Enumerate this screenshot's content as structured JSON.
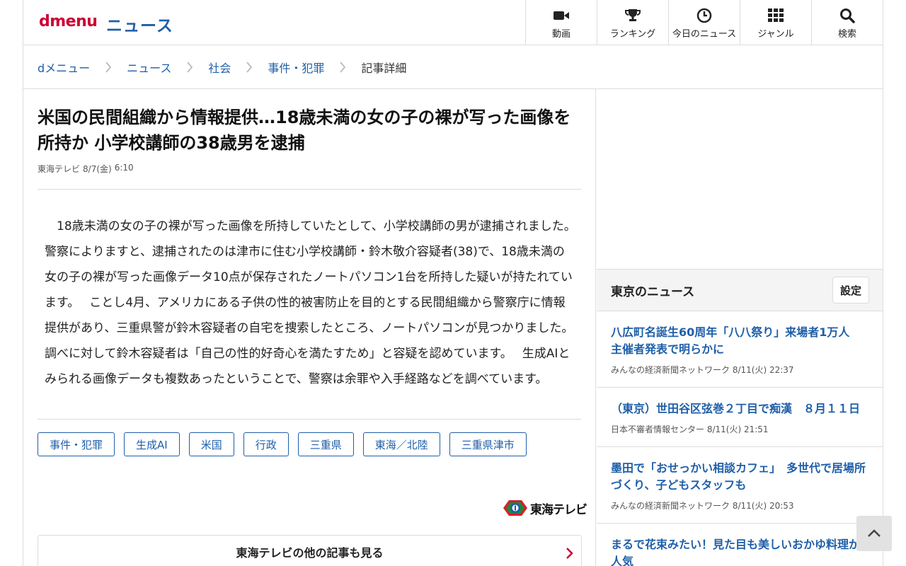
{
  "header": {
    "logo": "dmenu",
    "section": "ニュース",
    "nav": [
      {
        "label": "動画",
        "icon": "video-camera-icon"
      },
      {
        "label": "ランキング",
        "icon": "trophy-icon"
      },
      {
        "label": "今日のニュース",
        "icon": "clock-icon"
      },
      {
        "label": "ジャンル",
        "icon": "grid-icon"
      },
      {
        "label": "検索",
        "icon": "search-icon"
      }
    ]
  },
  "breadcrumb": [
    "dメニュー",
    "ニュース",
    "社会",
    "事件・犯罪",
    "記事詳細"
  ],
  "article": {
    "title": "米国の民間組織から情報提供…18歳未満の女の子の裸が写った画像を所持か 小学校講師の38歳男を逮捕",
    "source": "東海テレビ",
    "date": "8/7(金)",
    "time": "6:10",
    "body": "　18歳未満の女の子の裸が写った画像を所持していたとして、小学校講師の男が逮捕されました。　 警察によりますと、逮捕されたのは津市に住む小学校講師・鈴木敬介容疑者(38)で、18歳未満の女の子の裸が写った画像データ10点が保存されたノートパソコン1台を所持した疑いが持たれています。　 ことし4月、アメリカにある子供の性的被害防止を目的とする民間組織から警察庁に情報提供があり、三重県警が鈴木容疑者の自宅を捜索したところ、ノートパソコンが見つかりました。　 調べに対して鈴木容疑者は「自己の性的好奇心を満たすため」と容疑を認めています。　 生成AIとみられる画像データも複数あったということで、警察は余罪や入手経路などを調べています。",
    "tags": [
      "事件・犯罪",
      "生成AI",
      "米国",
      "行政",
      "三重県",
      "東海／北陸",
      "三重県津市"
    ],
    "source_logo_text": "東海テレビ",
    "more_label": "東海テレビの他の記事も見る"
  },
  "sidebar": {
    "title": "東京のニュース",
    "settings_label": "設定",
    "items": [
      {
        "headline": "八広町名誕生60周年「八八祭り」来場者1万人　主催者発表で明らかに",
        "source": "みんなの経済新聞ネットワーク",
        "date": "8/11(火)",
        "time": "22:37"
      },
      {
        "headline": "（東京）世田谷区弦巻２丁目で痴漢　８月１１日",
        "source": "日本不審者情報センター",
        "date": "8/11(火)",
        "time": "21:51"
      },
      {
        "headline": "墨田で「おせっかい相談カフェ」　多世代で居場所づくり、子どもスタッフも",
        "source": "みんなの経済新聞ネットワーク",
        "date": "8/11(火)",
        "time": "20:53"
      },
      {
        "headline": "まるで花束みたい！見た目も美しいおかゆ料理が人気",
        "source": "",
        "date": "",
        "time": ""
      }
    ]
  },
  "colors": {
    "brand_red": "#cc0033",
    "link_blue": "#1f5fa8"
  }
}
